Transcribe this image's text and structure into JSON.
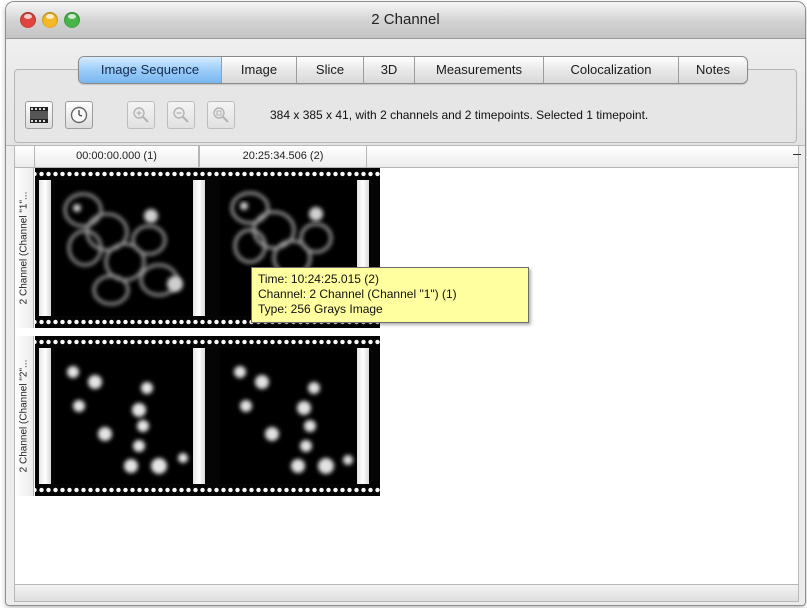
{
  "window": {
    "title": "2 Channel",
    "traffic_colors": {
      "close": "#e0443e",
      "minimize": "#f3b827",
      "zoom": "#48b449"
    }
  },
  "tabs": [
    {
      "label": "Image Sequence",
      "active": true
    },
    {
      "label": "Image",
      "active": false
    },
    {
      "label": "Slice",
      "active": false
    },
    {
      "label": "3D",
      "active": false
    },
    {
      "label": "Measurements",
      "active": false
    },
    {
      "label": "Colocalization",
      "active": false
    },
    {
      "label": "Notes",
      "active": false
    }
  ],
  "toolbar": {
    "buttons": [
      {
        "icon": "filmstrip-view-icon",
        "enabled": true
      },
      {
        "icon": "clock-icon",
        "enabled": true
      },
      {
        "icon": "zoom-in-icon",
        "enabled": false
      },
      {
        "icon": "zoom-out-icon",
        "enabled": false
      },
      {
        "icon": "zoom-fit-icon",
        "enabled": false
      }
    ],
    "status_text": "384 x 385 x 41, with 2 channels and 2 timepoints.  Selected 1 timepoint."
  },
  "grid": {
    "column_headers": [
      "00:00:00.000 (1)",
      "20:25:34.506 (2)"
    ],
    "row_headers": [
      "2 Channel  (Channel \"1\"...",
      "2 Channel  (Channel \"2\"..."
    ],
    "rows": [
      {
        "channel": "Channel 1",
        "content": "cell membranes, grayscale"
      },
      {
        "channel": "Channel 2",
        "content": "cell nuclei, grayscale"
      }
    ]
  },
  "tooltip": {
    "line1": "Time: 10:24:25.015 (2)",
    "line2": "Channel: 2 Channel  (Channel \"1\") (1)",
    "line3": "Type: 256 Grays Image"
  }
}
